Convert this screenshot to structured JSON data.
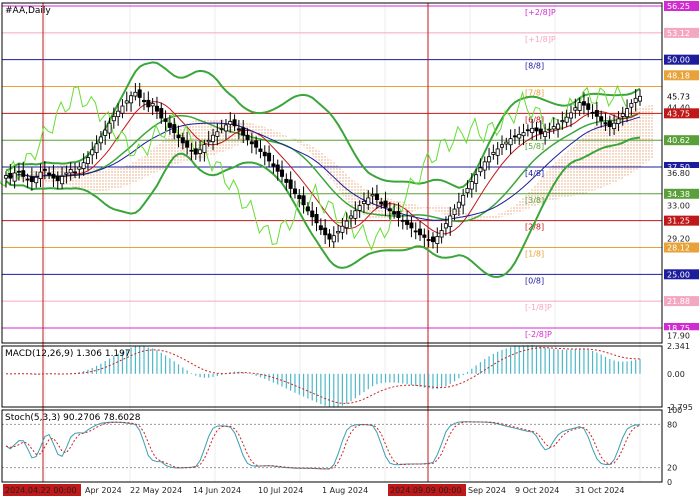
{
  "window": {
    "title": "#AA,Daily"
  },
  "price_labels": [
    {
      "text": "56.25",
      "bg": "#d22bd2",
      "fg": "#ffffff"
    },
    {
      "text": "53.12",
      "bg": "#f4a8c0",
      "fg": "#ffffff"
    },
    {
      "text": "50.00",
      "bg": "#1c1c9c",
      "fg": "#ffffff"
    },
    {
      "text": "48.18",
      "bg": "#e8a23a",
      "fg": "#ffffff"
    },
    {
      "text": "45.73",
      "bg": "#ffffff",
      "fg": "#000000"
    },
    {
      "text": "44.40",
      "bg": "#ffffff",
      "fg": "#222222"
    },
    {
      "text": "43.75",
      "bg": "#c01818",
      "fg": "#ffffff"
    },
    {
      "text": "40.62",
      "bg": "#5aa03a",
      "fg": "#ffffff"
    },
    {
      "text": "37.50",
      "bg": "#1c1c9c",
      "fg": "#ffffff"
    },
    {
      "text": "36.80",
      "bg": "#ffffff",
      "fg": "#222222"
    },
    {
      "text": "34.38",
      "bg": "#5aa03a",
      "fg": "#ffffff"
    },
    {
      "text": "33.00",
      "bg": "#ffffff",
      "fg": "#222222"
    },
    {
      "text": "31.25",
      "bg": "#c01818",
      "fg": "#ffffff"
    },
    {
      "text": "29.20",
      "bg": "#ffffff",
      "fg": "#222222"
    },
    {
      "text": "28.12",
      "bg": "#e8a23a",
      "fg": "#ffffff"
    },
    {
      "text": "25.00",
      "bg": "#1c1c9c",
      "fg": "#ffffff"
    },
    {
      "text": "21.88",
      "bg": "#f4a8c0",
      "fg": "#ffffff"
    },
    {
      "text": "18.75",
      "bg": "#d22bd2",
      "fg": "#ffffff"
    },
    {
      "text": "17.90",
      "bg": "#ffffff",
      "fg": "#222222"
    }
  ],
  "macd_labels": [
    "2.341",
    "0.00",
    "-2.795"
  ],
  "stoch_labels": [
    "100",
    "80",
    "20",
    "0"
  ],
  "x_labels": [
    "2024.04.22 00:00",
    "Apr 2024",
    "22 May 2024",
    "14 Jun 2024",
    "10 Jul 2024",
    "1 Aug 2024",
    "2024.09.09 00:00",
    "Sep 2024",
    "9 Oct 2024",
    "31 Oct 2024"
  ],
  "chart_data": [
    {
      "type": "candlestick",
      "title": "#AA,Daily",
      "y_ticks": [
        56.25,
        53.12,
        50.0,
        48.18,
        45.73,
        44.4,
        43.75,
        40.62,
        37.5,
        36.8,
        34.38,
        33.0,
        31.25,
        29.2,
        28.12,
        25.0,
        21.88,
        18.75,
        17.9
      ],
      "ylim": [
        17.0,
        56.6
      ],
      "murrey_levels": [
        {
          "label": "[+2/8]P",
          "value": 56.25,
          "color": "#d22bd2"
        },
        {
          "label": "[+1/8]P",
          "value": 53.12,
          "color": "#f4a8c0"
        },
        {
          "label": "[8/8]",
          "value": 50.0,
          "color": "#1c1c9c"
        },
        {
          "label": "[7/8]",
          "value": 46.88,
          "color": "#e8a23a"
        },
        {
          "label": "[6/8]",
          "value": 43.75,
          "color": "#c01818"
        },
        {
          "label": "[5/8]",
          "value": 40.62,
          "color": "#5aa03a"
        },
        {
          "label": "[4/8]",
          "value": 37.5,
          "color": "#1c1c9c"
        },
        {
          "label": "[3/8]",
          "value": 34.38,
          "color": "#5aa03a"
        },
        {
          "label": "[2/8]",
          "value": 31.25,
          "color": "#c01818"
        },
        {
          "label": "[1/8]",
          "value": 28.12,
          "color": "#e8a23a"
        },
        {
          "label": "[0/8]",
          "value": 25.0,
          "color": "#1c1c9c"
        },
        {
          "label": "[-1/8]P",
          "value": 21.88,
          "color": "#f4a8c0"
        },
        {
          "label": "[-2/8]P",
          "value": 18.75,
          "color": "#d22bd2"
        }
      ],
      "last_price": 45.73,
      "close": [
        36.5,
        36.2,
        36.8,
        37.0,
        36.4,
        36.0,
        35.8,
        36.3,
        36.9,
        37.1,
        36.6,
        36.2,
        35.9,
        36.4,
        36.8,
        37.2,
        36.9,
        37.5,
        38.0,
        38.6,
        39.5,
        40.2,
        41.0,
        41.8,
        42.6,
        43.4,
        44.0,
        44.6,
        45.2,
        45.8,
        46.2,
        45.6,
        45.1,
        44.5,
        44.9,
        44.0,
        43.2,
        42.8,
        42.1,
        41.5,
        40.9,
        40.3,
        39.8,
        39.4,
        39.0,
        39.5,
        40.1,
        40.6,
        41.2,
        41.6,
        42.0,
        42.4,
        42.8,
        42.3,
        41.8,
        41.2,
        40.7,
        40.2,
        39.8,
        39.3,
        38.8,
        38.2,
        37.6,
        37.0,
        36.4,
        35.7,
        35.0,
        34.4,
        33.8,
        33.1,
        32.4,
        31.7,
        31.0,
        30.2,
        29.6,
        29.1,
        29.5,
        30.0,
        30.6,
        31.2,
        31.8,
        32.4,
        33.0,
        33.5,
        33.9,
        34.3,
        33.7,
        33.2,
        32.8,
        32.4,
        32.0,
        31.6,
        31.2,
        30.8,
        30.4,
        30.0,
        29.6,
        29.3,
        29.0,
        28.8,
        29.4,
        30.1,
        30.9,
        31.8,
        32.6,
        33.4,
        34.2,
        35.0,
        35.8,
        36.6,
        37.4,
        38.1,
        38.7,
        39.2,
        39.6,
        40.1,
        40.4,
        40.8,
        41.0,
        41.3,
        41.5,
        41.8,
        42.0,
        41.7,
        41.4,
        41.6,
        41.9,
        42.2,
        42.5,
        42.9,
        43.3,
        43.8,
        44.4,
        45.0,
        44.7,
        44.2,
        43.8,
        43.4,
        42.9,
        42.5,
        42.2,
        42.6,
        43.1,
        43.7,
        44.3,
        44.9,
        45.5,
        45.73
      ],
      "macd": {
        "params": "MACD(12,26,9)",
        "main": 1.306,
        "signal": 1.197,
        "ylim": [
          -2.795,
          2.341
        ]
      },
      "stochastic": {
        "params": "Stoch(5,3,3)",
        "k": 90.2706,
        "d": 78.6028,
        "ylim": [
          0,
          100
        ],
        "levels": [
          80,
          20
        ]
      }
    }
  ]
}
